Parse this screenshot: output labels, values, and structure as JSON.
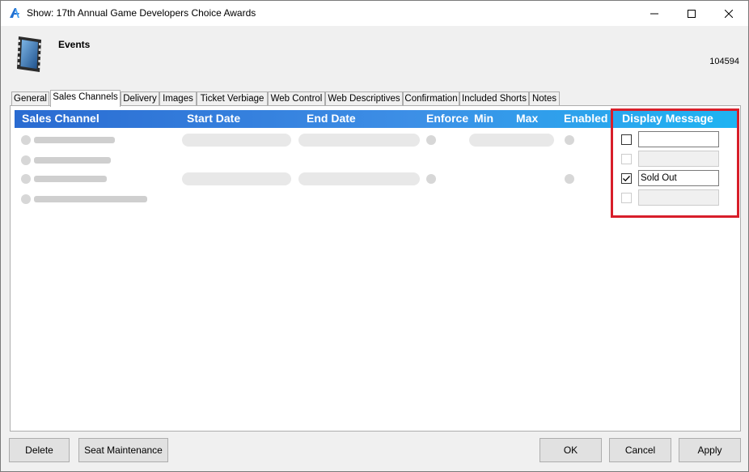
{
  "window": {
    "title": "Show: 17th Annual Game Developers Choice Awards"
  },
  "header": {
    "title": "Events",
    "record_id": "104594"
  },
  "tabs": [
    {
      "label": "General",
      "active": false
    },
    {
      "label": "Sales Channels",
      "active": true
    },
    {
      "label": "Delivery",
      "active": false
    },
    {
      "label": "Images",
      "active": false
    },
    {
      "label": "Ticket Verbiage",
      "active": false
    },
    {
      "label": "Web Control",
      "active": false
    },
    {
      "label": "Web Descriptives",
      "active": false
    },
    {
      "label": "Confirmation",
      "active": false
    },
    {
      "label": "Included Shorts",
      "active": false
    },
    {
      "label": "Notes",
      "active": false
    }
  ],
  "grid": {
    "columns": [
      "Sales Channel",
      "Start Date",
      "End Date",
      "Enforce",
      "Min",
      "Max",
      "Enabled",
      "Display Message"
    ],
    "display_message_rows": [
      {
        "checked": false,
        "enabled": true,
        "message": ""
      },
      {
        "checked": false,
        "enabled": false,
        "message": ""
      },
      {
        "checked": true,
        "enabled": true,
        "message": "Sold Out"
      },
      {
        "checked": false,
        "enabled": false,
        "message": ""
      }
    ]
  },
  "buttons": {
    "delete": "Delete",
    "seat_maintenance": "Seat Maintenance",
    "ok": "OK",
    "cancel": "Cancel",
    "apply": "Apply"
  },
  "colors": {
    "header_gradient_start": "#2a6bd1",
    "header_gradient_end": "#1eb4f2",
    "highlight": "#d81e2a"
  }
}
